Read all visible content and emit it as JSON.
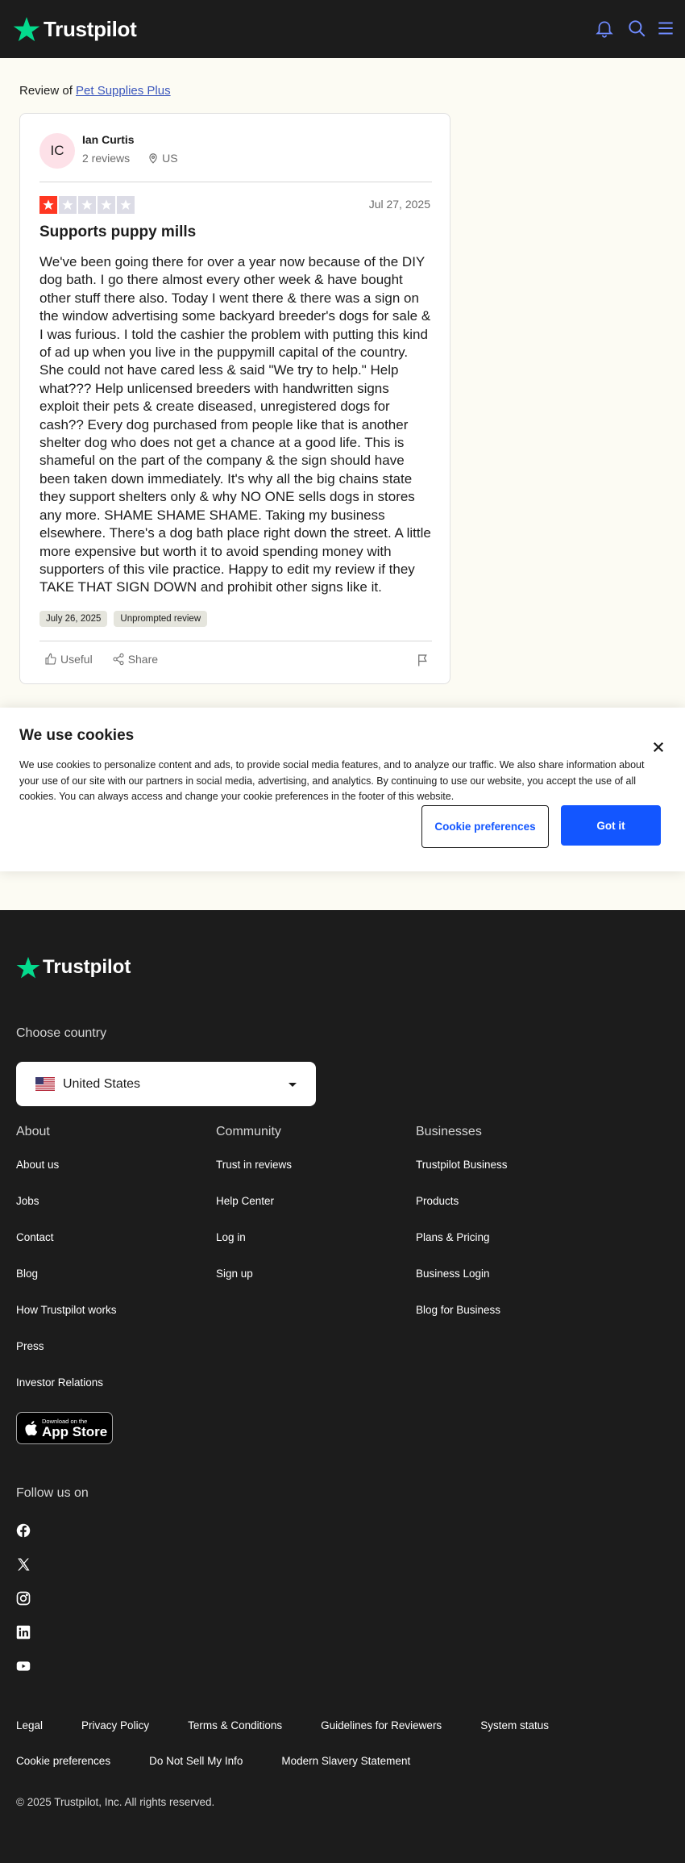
{
  "header": {
    "brand": "Trustpilot",
    "icons": [
      "bell-icon",
      "search-icon",
      "menu-icon"
    ],
    "colors": {
      "background": "#1c1c1c",
      "brand_green": "#04da8d"
    }
  },
  "breadcrumb": {
    "prefix": "Review of ",
    "company": "Pet Supplies Plus"
  },
  "review": {
    "initials": "IC",
    "name": "Ian Curtis",
    "review_count": "2 reviews",
    "country": "US",
    "rating": 1,
    "rating_max": 5,
    "date": "Jul 27, 2025",
    "title": "Supports puppy mills",
    "body": "We've been going there for over a year now because of the DIY dog bath. I go there almost every other week & have bought other stuff there also. Today I went there & there was a sign on the window advertising some backyard breeder's dogs for sale & I was furious. I told the cashier the problem with putting this kind of ad up when you live in the puppymill capital of the country. She could not have cared less & said \"We try to help.\" Help what??? Help unlicensed breeders with handwritten signs exploit their pets & create diseased, unregistered dogs for cash?? Every dog purchased from people like that is another shelter dog who does not get a chance at a good life. This is shameful on the part of the company & the sign should have been taken down immediately. It's why all the big chains state they support shelters only & why NO ONE sells dogs in stores any more. SHAME SHAME SHAME. Taking my business elsewhere. There's a dog bath place right down the street. A little more expensive but worth it to avoid spending money with supporters of this vile practice. Happy to edit my review if they TAKE THAT SIGN DOWN and prohibit other signs like it.",
    "experience_date": "July 26, 2025",
    "review_type": "Unprompted review",
    "useful_label": "Useful",
    "share_label": "Share",
    "star_color_on": "#ff3722",
    "star_color_off": "#dcdce6"
  },
  "cookie_banner": {
    "title": "We use cookies",
    "text": "We use cookies to personalize content and ads, to provide social media features, and to analyze our traffic. We also share information about your use of our site with our partners in social media, advertising, and analytics. By continuing to use our website, you accept the use of all cookies. You can always access and change your cookie preferences in the footer of this website.",
    "preferences_label": "Cookie preferences",
    "accept_label": "Got it",
    "accent": "#1356ff"
  },
  "footer": {
    "brand": "Trustpilot",
    "choose_country": "Choose country",
    "country": "United States",
    "columns": [
      {
        "title": "About",
        "links": [
          "About us",
          "Jobs",
          "Contact",
          "Blog",
          "How Trustpilot works",
          "Press",
          "Investor Relations"
        ]
      },
      {
        "title": "Community",
        "links": [
          "Trust in reviews",
          "Help Center",
          "Log in",
          "Sign up"
        ]
      },
      {
        "title": "Businesses",
        "links": [
          "Trustpilot Business",
          "Products",
          "Plans & Pricing",
          "Business Login",
          "Blog for Business"
        ]
      }
    ],
    "app_store": {
      "small": "Download on the",
      "big": "App Store"
    },
    "follow_us": "Follow us on",
    "social": [
      "facebook-icon",
      "x-icon",
      "instagram-icon",
      "linkedin-icon",
      "youtube-icon"
    ],
    "legal_links_row1": [
      "Legal",
      "Privacy Policy",
      "Terms & Conditions",
      "Guidelines for Reviewers",
      "System status"
    ],
    "legal_links_row2": [
      "Cookie preferences",
      "Do Not Sell My Info",
      "Modern Slavery Statement"
    ],
    "copyright": "© 2025 Trustpilot, Inc. All rights reserved."
  }
}
